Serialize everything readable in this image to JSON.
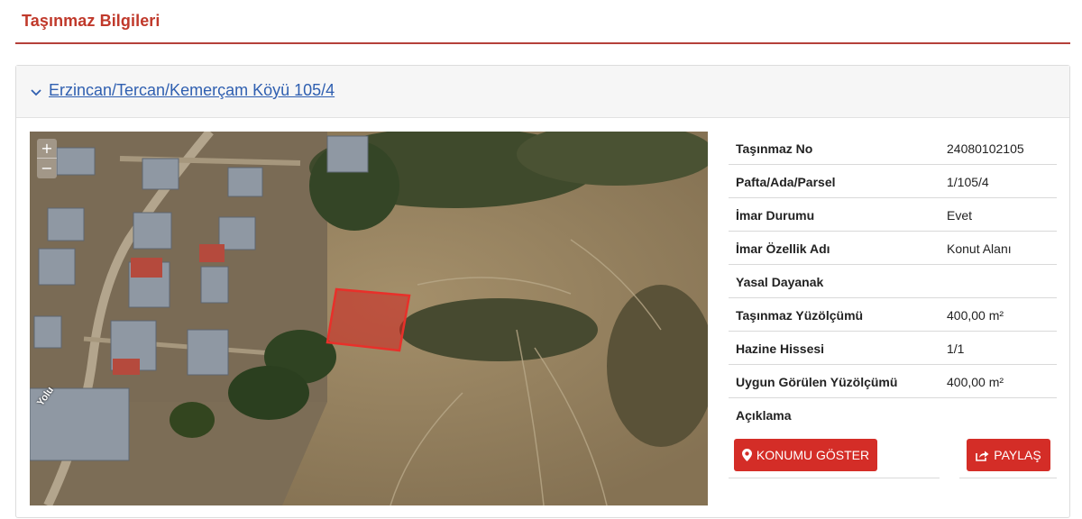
{
  "page": {
    "title": "Taşınmaz Bilgileri"
  },
  "card": {
    "link_text": "Erzincan/Tercan/Kemerçam Köyü 105/4"
  },
  "map": {
    "zoom_in": "+",
    "zoom_out": "−",
    "road_label": "Yolu"
  },
  "info": {
    "rows": [
      {
        "label": "Taşınmaz No",
        "value": "24080102105"
      },
      {
        "label": "Pafta/Ada/Parsel",
        "value": "1/105/4"
      },
      {
        "label": "İmar Durumu",
        "value": "Evet"
      },
      {
        "label": "İmar Özellik Adı",
        "value": "Konut Alanı"
      },
      {
        "label": "Yasal Dayanak",
        "value": ""
      },
      {
        "label": "Taşınmaz Yüzölçümü",
        "value": "400,00 m²"
      },
      {
        "label": "Hazine Hissesi",
        "value": "1/1"
      },
      {
        "label": "Uygun Görülen Yüzölçümü",
        "value": "400,00 m²"
      },
      {
        "label": "Açıklama",
        "value": ""
      }
    ]
  },
  "buttons": {
    "show_location": "KONUMU GÖSTER",
    "share": "PAYLAŞ"
  },
  "colors": {
    "accent": "#d42d27",
    "title": "#c0392b",
    "link": "#2f5fb0",
    "parcel": "#e8302a"
  }
}
